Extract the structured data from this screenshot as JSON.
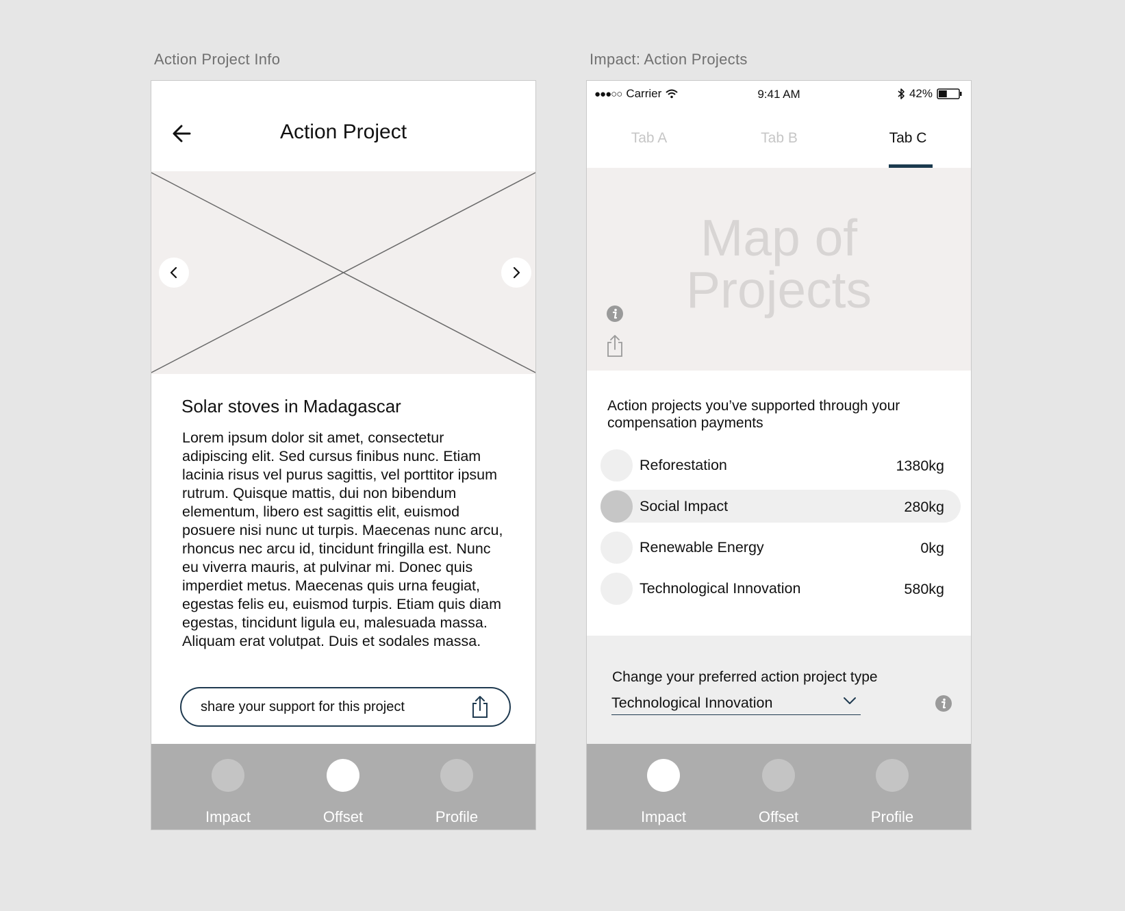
{
  "labels": {
    "left_artboard": "Action Project Info",
    "right_artboard": "Impact: Action Projects"
  },
  "left": {
    "title": "Action Project",
    "project_title": "Solar stoves in Madagascar",
    "project_body": "Lorem ipsum dolor sit amet, consectetur adipiscing elit. Sed cursus finibus nunc. Etiam lacinia risus vel purus sagittis, vel porttitor ipsum rutrum. Quisque mattis, dui non bibendum elementum, libero est sagittis elit, euismod posuere nisi nunc ut turpis. Maecenas nunc arcu, rhoncus nec arcu id, tincidunt fringilla est. Nunc eu viverra mauris, at pulvinar mi. Donec quis imperdiet metus. Maecenas quis urna feugiat, egestas felis eu, euismod turpis. Etiam quis diam egestas, tincidunt ligula eu, malesuada massa. Aliquam erat volutpat. Duis et sodales massa.",
    "share_label": "share your support for this project",
    "nav": [
      {
        "label": "Impact",
        "active": false
      },
      {
        "label": "Offset",
        "active": true
      },
      {
        "label": "Profile",
        "active": false
      }
    ]
  },
  "right": {
    "status": {
      "signal": "●●●○○",
      "carrier": "Carrier",
      "time": "9:41 AM",
      "battery": "42%",
      "battery_level": 0.42
    },
    "tabs": [
      {
        "label": "Tab A",
        "active": false
      },
      {
        "label": "Tab B",
        "active": false
      },
      {
        "label": "Tab C",
        "active": true
      }
    ],
    "map_title_line1": "Map of",
    "map_title_line2": "Projects",
    "supported_text": "Action projects you’ve supported through your compensation payments",
    "projects": [
      {
        "name": "Reforestation",
        "value": "1380kg",
        "selected": false
      },
      {
        "name": "Social Impact",
        "value": "280kg",
        "selected": true
      },
      {
        "name": "Renewable Energy",
        "value": "0kg",
        "selected": false
      },
      {
        "name": "Technological Innovation",
        "value": "580kg",
        "selected": false
      }
    ],
    "pref_label": "Change your preferred action project type",
    "pref_value": "Technological Innovation",
    "nav": [
      {
        "label": "Impact",
        "active": true
      },
      {
        "label": "Offset",
        "active": false
      },
      {
        "label": "Profile",
        "active": false
      }
    ]
  },
  "colors": {
    "accent": "#1b3a4e",
    "background": "#e6e6e6",
    "nav_bar": "#adadad",
    "placeholder": "#f2efee"
  }
}
